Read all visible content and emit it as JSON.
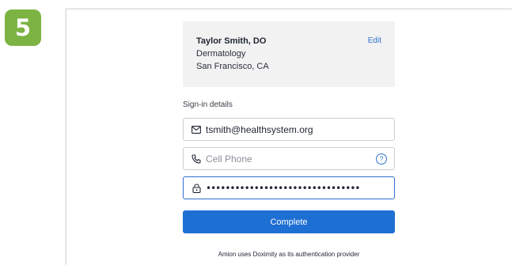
{
  "step": {
    "number": "5"
  },
  "doctor": {
    "name": "Taylor Smith, DO",
    "specialty": "Dermatology",
    "location": "San Francisco, CA",
    "edit_label": "Edit"
  },
  "signin": {
    "section_label": "Sign-in details",
    "email_value": "tsmith@healthsystem.org",
    "phone_placeholder": "Cell Phone",
    "phone_help_glyph": "?",
    "password_masked": "••••••••••••••••••••••••••••••••"
  },
  "actions": {
    "complete_label": "Complete"
  },
  "footer": {
    "note": "Amion uses Doximity as its authentication provider"
  },
  "colors": {
    "accent": "#1e6fd3",
    "badge": "#7cb342",
    "card_bg": "#f2f2f2"
  }
}
